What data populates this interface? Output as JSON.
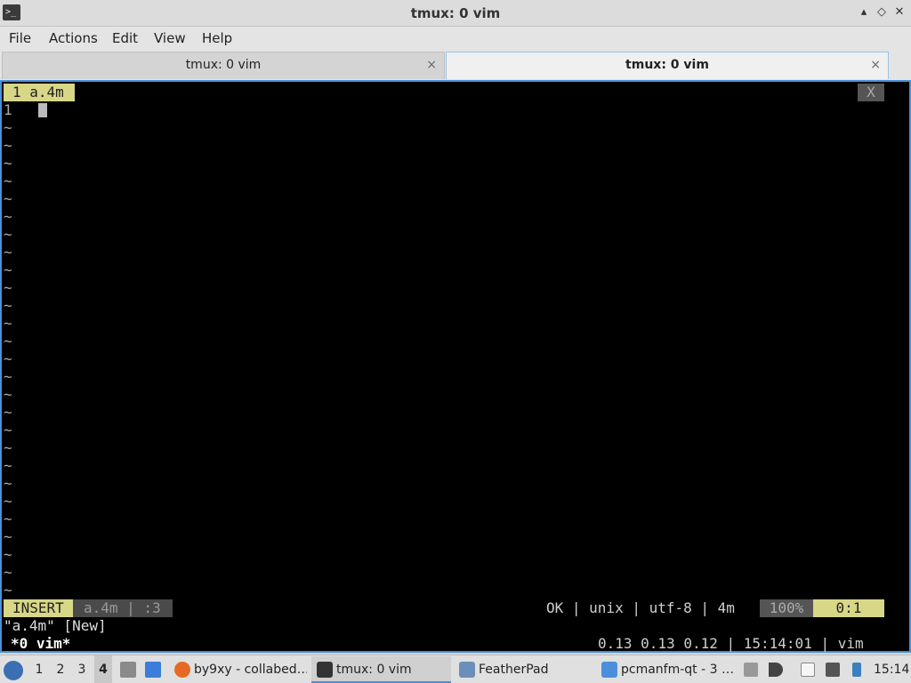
{
  "window": {
    "title": "tmux: 0 vim",
    "app_icon": ">_",
    "min_glyph": "▴",
    "max_glyph": "◇",
    "close_glyph": "✕"
  },
  "menu": [
    "File",
    "Actions",
    "Edit",
    "View",
    "Help"
  ],
  "tabs": [
    {
      "label": "tmux: 0 vim",
      "active": false,
      "close": "×"
    },
    {
      "label": "tmux: 0 vim",
      "active": true,
      "close": "×"
    }
  ],
  "vim": {
    "tabline_label": "1 a.4m",
    "tabline_close": "X",
    "line_number": "1",
    "tilde": "~",
    "mode": "INSERT",
    "file_info": "a.4m | :3",
    "right_info": "OK | unix | utf-8 | 4m",
    "percent": "100%",
    "position": "0:1",
    "message": "\"a.4m\" [New]"
  },
  "tmux": {
    "window_label": "*0 vim*",
    "status_right": "0.13 0.13 0.12 | 15:14:01 | vim"
  },
  "taskbar": {
    "workspaces": [
      "1",
      "2",
      "3",
      "4"
    ],
    "active_workspace": "4",
    "tasks": [
      {
        "label": "by9xy - collabed…",
        "icon": "firefox-icon"
      },
      {
        "label": "tmux: 0 vim",
        "icon": "terminal-icon",
        "active": true
      },
      {
        "label": "FeatherPad",
        "icon": "featherpad-icon"
      },
      {
        "label": "pcmanfm-qt - 3 …",
        "icon": "folder-icon"
      }
    ],
    "clock": "15:14"
  },
  "colors": {
    "accent": "#4a90d9",
    "airline_yellow": "#d7d787",
    "terminal_bg": "#000000"
  }
}
